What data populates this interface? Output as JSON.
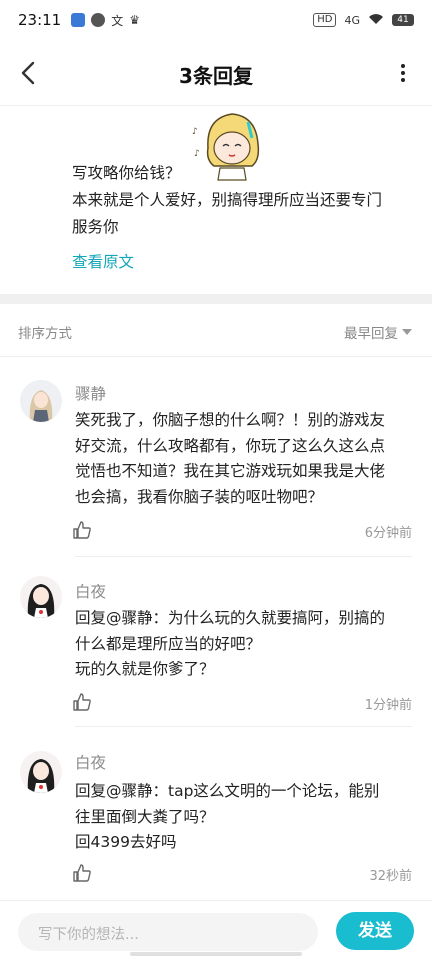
{
  "status_bar": {
    "time": "23:11",
    "left_icons": [
      "translate-icon",
      "chat-icon",
      "text-icon",
      "crown-icon"
    ],
    "network": "HD",
    "signal": "4G",
    "battery": "41"
  },
  "header": {
    "title": "3条回复"
  },
  "post": {
    "lines": [
      "写攻略你给钱？",
      "本来就是个人爱好，别搞得理所应当还要专门",
      "服务你"
    ],
    "view_original": "查看原文"
  },
  "sort": {
    "label": "排序方式",
    "value": "最早回复"
  },
  "comments": [
    {
      "name": "骤静",
      "lines": [
        "笑死我了，你脑子想的什么啊？！别的游戏友",
        "好交流，什么攻略都有，你玩了这么久这么点",
        "觉悟也不知道？我在其它游戏玩如果我是大佬",
        "也会搞，我看你脑子装的呕吐物吧？"
      ],
      "time": "6分钟前"
    },
    {
      "name": "白夜",
      "lines": [
        "回复@骤静：为什么玩的久就要搞阿，别搞的",
        "什么都是理所应当的好吧？",
        "玩的久就是你爹了？"
      ],
      "time": "1分钟前"
    },
    {
      "name": "白夜",
      "lines": [
        "回复@骤静：tap这么文明的一个论坛，能别",
        "往里面倒大粪了吗？",
        "回4399去好吗"
      ],
      "time": "32秒前"
    }
  ],
  "input_bar": {
    "placeholder": "写下你的想法...",
    "send_label": "发送"
  },
  "colors": {
    "accent": "#19bdcf",
    "link": "#15a6b8"
  }
}
